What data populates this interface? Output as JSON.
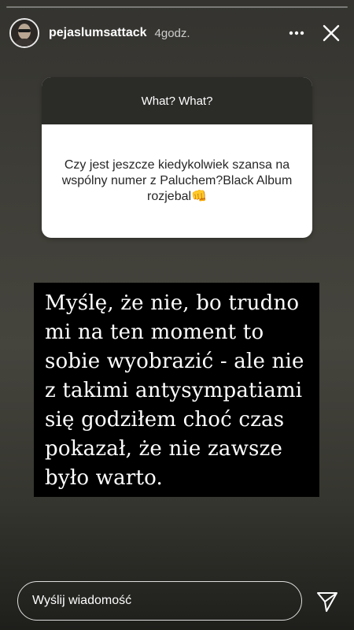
{
  "story": {
    "progress": 0.0
  },
  "header": {
    "username": "pejaslumsattack",
    "time": "4godz."
  },
  "question_card": {
    "title": "What? What?",
    "question": "Czy jest jeszcze kiedykolwiek szansa na wspólny numer z Paluchem?Black Album rozjebal",
    "emoji": "👊"
  },
  "answer": {
    "lines": [
      "Myślę, że nie, bo trudno",
      "mi na ten moment to",
      "sobie wyobrazić - ale nie",
      "z takimi antysympatiami",
      "się godziłem choć czas",
      "pokazał, że nie zawsze",
      "było warto."
    ]
  },
  "footer": {
    "reply_placeholder": "Wyślij wiadomość"
  },
  "icons": {
    "more": "more-dots-icon",
    "close": "close-icon",
    "send": "send-paper-plane-icon"
  }
}
